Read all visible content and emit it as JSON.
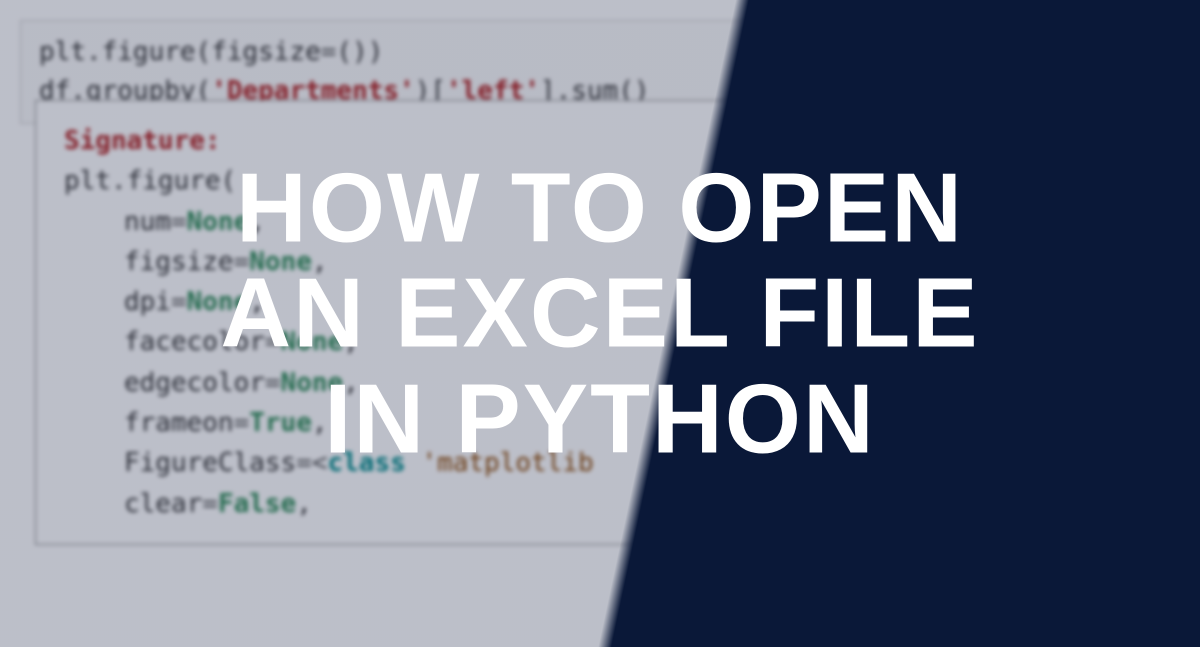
{
  "code": {
    "line1_pre": "plt.figure(figsize",
    "line1_eq": "=",
    "line1_post": "())",
    "line2_a": "df.groupby(",
    "line2_b": "'Departments'",
    "line2_c": ")[",
    "line2_d": "'left'",
    "line2_e": "].sum()"
  },
  "tooltip": {
    "sig": "Signature:",
    "head": "plt.figure(",
    "p1_k": "num",
    "p1_v": "None",
    "p2_k": "figsize",
    "p2_v": "None",
    "p3_k": "dpi",
    "p3_v": "None",
    "p4_k": "facecolor",
    "p4_v": "None",
    "p5_k": "edgecolor",
    "p5_v": "None",
    "p6_k": "frameon",
    "p6_v": "True",
    "p7_k": "FigureClass",
    "p7_c": "class",
    "p7_s": "'matplotlib",
    "p8_k": "clear",
    "p8_v": "False",
    "eq": "=",
    "comma": ",",
    "lt": "=<"
  },
  "headline": {
    "l1": "HOW TO OPEN",
    "l2": "AN EXCEL FILE",
    "l3": "IN PYTHON"
  }
}
